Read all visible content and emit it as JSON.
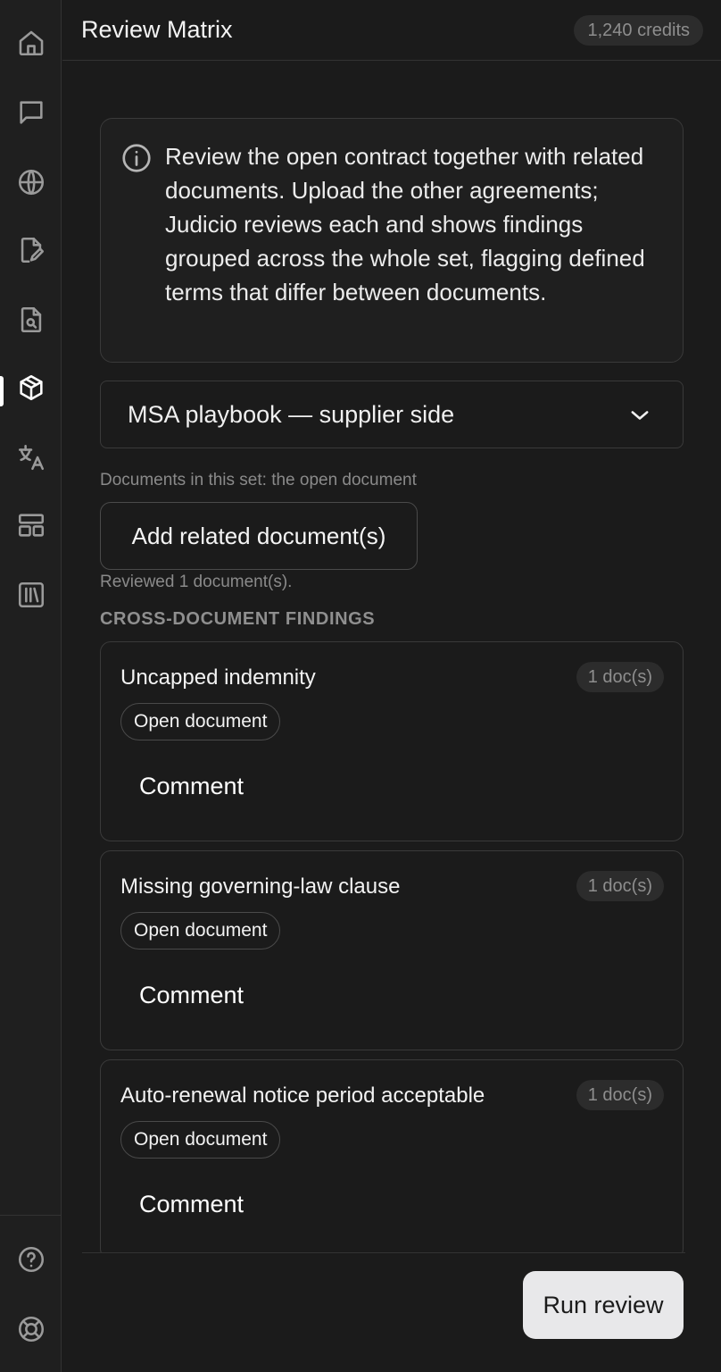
{
  "app": {
    "title": "Review Matrix",
    "credits": "1,240 credits"
  },
  "nav": {
    "items": [
      {
        "icon": "home-icon"
      },
      {
        "icon": "chat-icon"
      },
      {
        "icon": "globe-icon"
      },
      {
        "icon": "document-edit-icon"
      },
      {
        "icon": "document-search-icon"
      },
      {
        "icon": "cube-icon",
        "active": true
      },
      {
        "icon": "translate-icon"
      },
      {
        "icon": "layout-icon"
      },
      {
        "icon": "library-icon"
      }
    ],
    "bottom": [
      {
        "icon": "help-icon"
      },
      {
        "icon": "support-icon"
      }
    ]
  },
  "info": {
    "icon": "info-icon",
    "text": "Review the open contract together with related documents. Upload the other agreements; Judicio reviews each and shows findings grouped across the whole set, flagging defined terms that differ between documents."
  },
  "playbook": {
    "selected": "MSA playbook — supplier side",
    "icon": "chevron-down-icon"
  },
  "documents": {
    "note": "Documents in this set: the open document",
    "add_label": "Add related document(s)",
    "reviewed": "Reviewed 1 document(s)."
  },
  "findings": {
    "title": "CROSS-DOCUMENT FINDINGS",
    "items": [
      {
        "title": "Uncapped indemnity",
        "count": "1 doc(s)",
        "chip": "Open document",
        "comment": "Comment"
      },
      {
        "title": "Missing governing-law clause",
        "count": "1 doc(s)",
        "chip": "Open document",
        "comment": "Comment"
      },
      {
        "title": "Auto-renewal notice period acceptable",
        "count": "1 doc(s)",
        "chip": "Open document",
        "comment": "Comment"
      }
    ]
  },
  "footer": {
    "run_label": "Run review"
  },
  "colors": {
    "background": "#1b1b1b",
    "panel": "#1f1f1f",
    "border": "#3a3a3a",
    "muted_text": "#8a8a8a",
    "primary_button": "#e8e8ea"
  }
}
